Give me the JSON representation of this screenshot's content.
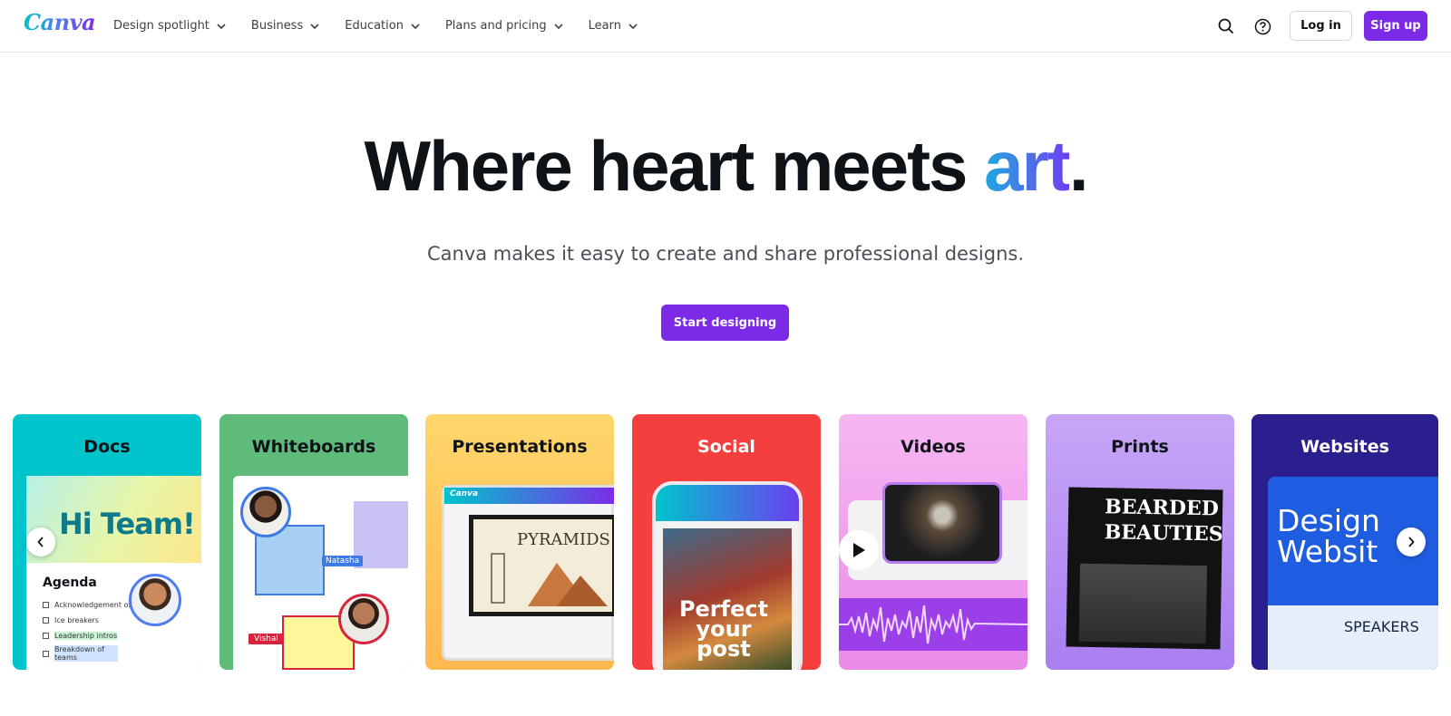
{
  "header": {
    "logo": "Canva",
    "nav": [
      {
        "label": "Design spotlight"
      },
      {
        "label": "Business"
      },
      {
        "label": "Education"
      },
      {
        "label": "Plans and pricing"
      },
      {
        "label": "Learn"
      }
    ],
    "login_label": "Log in",
    "signup_label": "Sign up",
    "icons": [
      "search-icon",
      "help-icon"
    ]
  },
  "hero": {
    "title_main": "Where heart meets ",
    "title_accent": "art",
    "title_end": ".",
    "subtitle": "Canva makes it easy to create and share professional designs.",
    "cta_label": "Start designing"
  },
  "cards": [
    {
      "title": "Docs",
      "color": "#00c4cc",
      "doc_heading": "Hi Team!",
      "agenda_title": "Agenda",
      "agenda_items": [
        "Acknowledgement of co",
        "Ice breakers",
        "Leadership intros",
        "Breakdown of teams"
      ]
    },
    {
      "title": "Whiteboards",
      "color": "#5fbb7a",
      "tag_1": "Natasha",
      "tag_2": "Vishal"
    },
    {
      "title": "Presentations",
      "color": "#ffc857",
      "mini_logo": "Canva",
      "slide_text": "PYRAMIDS"
    },
    {
      "title": "Social",
      "color": "#f53e3e",
      "post_text": "Perfect your post"
    },
    {
      "title": "Videos",
      "color": "#f5a8f0"
    },
    {
      "title": "Prints",
      "color": "#b794f4",
      "print_text_1": "BEARDED",
      "print_text_2": "BEAUTIES"
    },
    {
      "title": "Websites",
      "color": "#2b1f8f",
      "site_text": "Design Websit",
      "speakers_text": "SPEAKERS"
    }
  ],
  "carousel": {
    "prev_icon": "chevron-left-icon",
    "next_icon": "chevron-right-icon"
  }
}
